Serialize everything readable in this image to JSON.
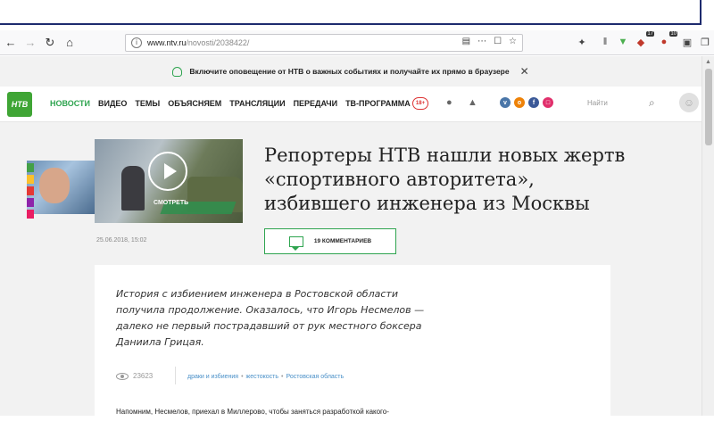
{
  "browser": {
    "url_host": "www.ntv.ru",
    "url_path": "/novosti/2038422/",
    "badge_1": "17",
    "badge_2": "10"
  },
  "notify": {
    "text": "Включите оповещение от НТВ о важных событиях и получайте их прямо в браузере"
  },
  "site": {
    "logo": "НТВ",
    "nav": [
      "НОВОСТИ",
      "ВИДЕО",
      "ТЕМЫ",
      "ОБЪЯСНЯЕМ",
      "ТРАНСЛЯЦИИ",
      "ПЕРЕДАЧИ",
      "ТВ-ПРОГРАММА"
    ],
    "age": "18+",
    "search_placeholder": "Найти",
    "accent": "#2ea44f"
  },
  "article": {
    "watch_label": "СМОТРЕТЬ",
    "title_lines": [
      "Репортеры НТВ нашли новых жертв",
      "«спортивного авторитета»,",
      "избившего инженера из Москвы"
    ],
    "date": "25.06.2018, 15:02",
    "comments": "19 КОММЕНТАРИЕВ",
    "lead_lines": [
      "История с избиением инженера в Ростовской области",
      "получила продолжение. Оказалось, что Игорь Несмелов —",
      "далеко не первый пострадавший от рук местного боксера",
      "Даниила Грицая."
    ],
    "views": "23623",
    "tags": [
      "драки и избиения",
      "жестокость",
      "Ростовская область"
    ],
    "body_start": "Напомним, Несмелов, приехал в Миллерово, чтобы заняться разработкой какого-"
  }
}
